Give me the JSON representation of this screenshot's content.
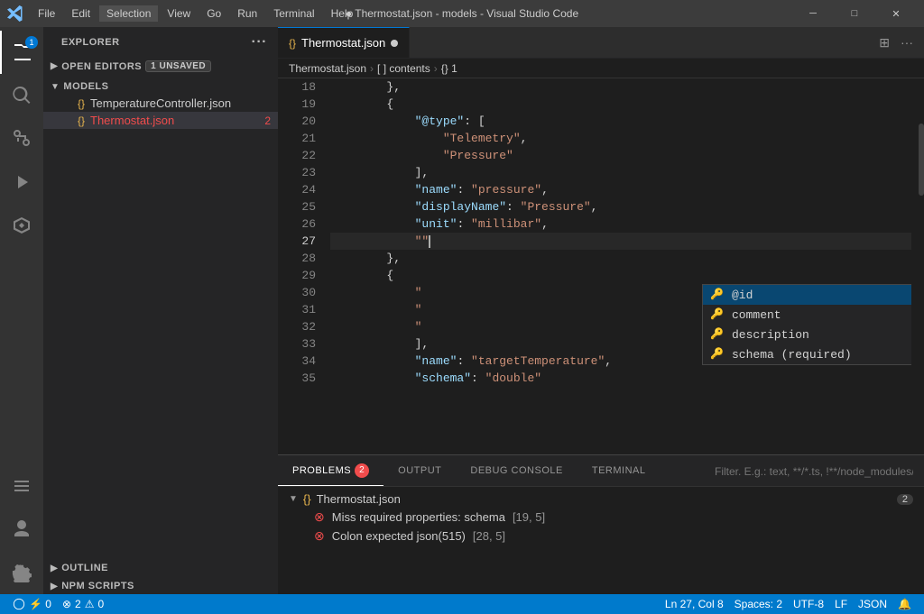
{
  "titlebar": {
    "title": "● Thermostat.json - models - Visual Studio Code",
    "menus": [
      "File",
      "Edit",
      "Selection",
      "View",
      "Go",
      "Run",
      "Terminal",
      "Help"
    ],
    "active_menu": "Selection",
    "window_controls": [
      "─",
      "☐",
      "✕"
    ]
  },
  "activity_bar": {
    "icons": [
      {
        "name": "explorer-icon",
        "symbol": "⊞",
        "active": true,
        "badge": "1"
      },
      {
        "name": "search-icon",
        "symbol": "🔍",
        "active": false
      },
      {
        "name": "source-control-icon",
        "symbol": "⎇",
        "active": false
      },
      {
        "name": "run-debug-icon",
        "symbol": "▷",
        "active": false
      },
      {
        "name": "extensions-icon",
        "symbol": "⊞",
        "active": false
      },
      {
        "name": "remote-explorer-icon",
        "symbol": "◫",
        "active": false
      },
      {
        "name": "accounts-icon",
        "symbol": "◯",
        "active": false
      },
      {
        "name": "settings-icon",
        "symbol": "⚙",
        "active": false
      }
    ]
  },
  "sidebar": {
    "header": "Explorer",
    "open_editors_label": "Open Editors",
    "open_editors_badge": "1 UNSAVED",
    "open_editors_files": [
      {
        "name": "Thermostat.json",
        "icon": "{}",
        "unsaved": true
      }
    ],
    "models_label": "Models",
    "models_files": [
      {
        "name": "TemperatureController.json",
        "icon": "{}",
        "error": false
      },
      {
        "name": "Thermostat.json",
        "icon": "{}",
        "error": true,
        "error_count": "2"
      }
    ],
    "outline_label": "Outline",
    "npm_label": "NPM Scripts"
  },
  "breadcrumb": {
    "parts": [
      "Thermostat.json",
      "[ ] contents",
      "{} 1"
    ]
  },
  "tab": {
    "name": "Thermostat.json",
    "unsaved": true,
    "icon": "{}"
  },
  "editor": {
    "lines": [
      {
        "num": 18,
        "content": "        },",
        "tokens": [
          {
            "text": "        },",
            "cls": "s-punc"
          }
        ]
      },
      {
        "num": 19,
        "content": "        {",
        "tokens": [
          {
            "text": "        {",
            "cls": "s-bracket"
          }
        ]
      },
      {
        "num": 20,
        "content": "            \"@type\": [",
        "tokens": [
          {
            "text": "            ",
            "cls": ""
          },
          {
            "text": "\"@type\"",
            "cls": "s-key"
          },
          {
            "text": ": [",
            "cls": "s-punc"
          }
        ]
      },
      {
        "num": 21,
        "content": "                \"Telemetry\",",
        "tokens": [
          {
            "text": "                ",
            "cls": ""
          },
          {
            "text": "\"Telemetry\"",
            "cls": "s-string"
          },
          {
            "text": ",",
            "cls": "s-punc"
          }
        ]
      },
      {
        "num": 22,
        "content": "                \"Pressure\"",
        "tokens": [
          {
            "text": "                ",
            "cls": ""
          },
          {
            "text": "\"Pressure\"",
            "cls": "s-string"
          }
        ]
      },
      {
        "num": 23,
        "content": "            ],",
        "tokens": [
          {
            "text": "            ],",
            "cls": "s-punc"
          }
        ]
      },
      {
        "num": 24,
        "content": "            \"name\": \"pressure\",",
        "tokens": [
          {
            "text": "            ",
            "cls": ""
          },
          {
            "text": "\"name\"",
            "cls": "s-key"
          },
          {
            "text": ": ",
            "cls": "s-punc"
          },
          {
            "text": "\"pressure\"",
            "cls": "s-string"
          },
          {
            "text": ",",
            "cls": "s-punc"
          }
        ]
      },
      {
        "num": 25,
        "content": "            \"displayName\": \"Pressure\",",
        "tokens": [
          {
            "text": "            ",
            "cls": ""
          },
          {
            "text": "\"displayName\"",
            "cls": "s-key"
          },
          {
            "text": ": ",
            "cls": "s-punc"
          },
          {
            "text": "\"Pressure\"",
            "cls": "s-string"
          },
          {
            "text": ",",
            "cls": "s-punc"
          }
        ]
      },
      {
        "num": 26,
        "content": "            \"unit\": \"millibar\",",
        "tokens": [
          {
            "text": "            ",
            "cls": ""
          },
          {
            "text": "\"unit\"",
            "cls": "s-key"
          },
          {
            "text": ": ",
            "cls": "s-punc"
          },
          {
            "text": "\"millibar\"",
            "cls": "s-string"
          },
          {
            "text": ",",
            "cls": "s-punc"
          }
        ]
      },
      {
        "num": 27,
        "content": "            \"\"",
        "tokens": [
          {
            "text": "            ",
            "cls": ""
          },
          {
            "text": "\"\"",
            "cls": "s-string"
          }
        ],
        "active": true
      },
      {
        "num": 28,
        "content": "        },",
        "tokens": [
          {
            "text": "        ",
            "cls": ""
          },
          {
            "text": "},",
            "cls": "s-punc"
          }
        ]
      },
      {
        "num": 29,
        "content": "        {",
        "tokens": [
          {
            "text": "        {",
            "cls": "s-bracket"
          }
        ]
      },
      {
        "num": 30,
        "content": "            \"",
        "tokens": [
          {
            "text": "            ",
            "cls": ""
          },
          {
            "text": "\"",
            "cls": "s-string"
          }
        ]
      },
      {
        "num": 31,
        "content": "            \"",
        "tokens": [
          {
            "text": "            ",
            "cls": ""
          },
          {
            "text": "\"",
            "cls": "s-string"
          }
        ]
      },
      {
        "num": 32,
        "content": "            \"",
        "tokens": [
          {
            "text": "            ",
            "cls": ""
          },
          {
            "text": "\"",
            "cls": "s-string"
          }
        ]
      },
      {
        "num": 33,
        "content": "            ],",
        "tokens": [
          {
            "text": "            ],",
            "cls": "s-punc"
          }
        ]
      },
      {
        "num": 34,
        "content": "            \"name\": \"targetTemperature\",",
        "tokens": [
          {
            "text": "            ",
            "cls": ""
          },
          {
            "text": "\"name\"",
            "cls": "s-key"
          },
          {
            "text": ": ",
            "cls": "s-punc"
          },
          {
            "text": "\"targetTemperature\"",
            "cls": "s-string"
          },
          {
            "text": ",",
            "cls": "s-punc"
          }
        ]
      },
      {
        "num": 35,
        "content": "            \"schema\": \"double\"",
        "tokens": [
          {
            "text": "            ",
            "cls": ""
          },
          {
            "text": "\"schema\"",
            "cls": "s-key"
          },
          {
            "text": ": ",
            "cls": "s-punc"
          },
          {
            "text": "\"double\"",
            "cls": "s-string"
          }
        ]
      }
    ]
  },
  "autocomplete": {
    "items": [
      {
        "text": "@id",
        "icon": "🔑",
        "selected": true
      },
      {
        "text": "comment",
        "icon": "🔑"
      },
      {
        "text": "description",
        "icon": "🔑"
      },
      {
        "text": "schema (required)",
        "icon": "🔑"
      }
    ]
  },
  "panel": {
    "tabs": [
      {
        "label": "PROBLEMS",
        "badge": "2",
        "active": true
      },
      {
        "label": "OUTPUT",
        "active": false
      },
      {
        "label": "DEBUG CONSOLE",
        "active": false
      },
      {
        "label": "TERMINAL",
        "active": false
      }
    ],
    "filter_placeholder": "Filter. E.g.: text, **/*.ts, !**/node_modules/**",
    "problems": {
      "file": "Thermostat.json",
      "count": "2",
      "items": [
        {
          "text": "Miss required properties: schema",
          "location": "[19, 5]"
        },
        {
          "text": "Colon expected  json(515)",
          "location": "[28, 5]"
        }
      ]
    }
  },
  "statusbar": {
    "errors": "2",
    "warnings": "0",
    "position": "Ln 27, Col 8",
    "spaces": "Spaces: 2",
    "encoding": "UTF-8",
    "line_ending": "LF",
    "language": "JSON",
    "notifications_icon": "🔔",
    "remote_icon": "⚡"
  }
}
